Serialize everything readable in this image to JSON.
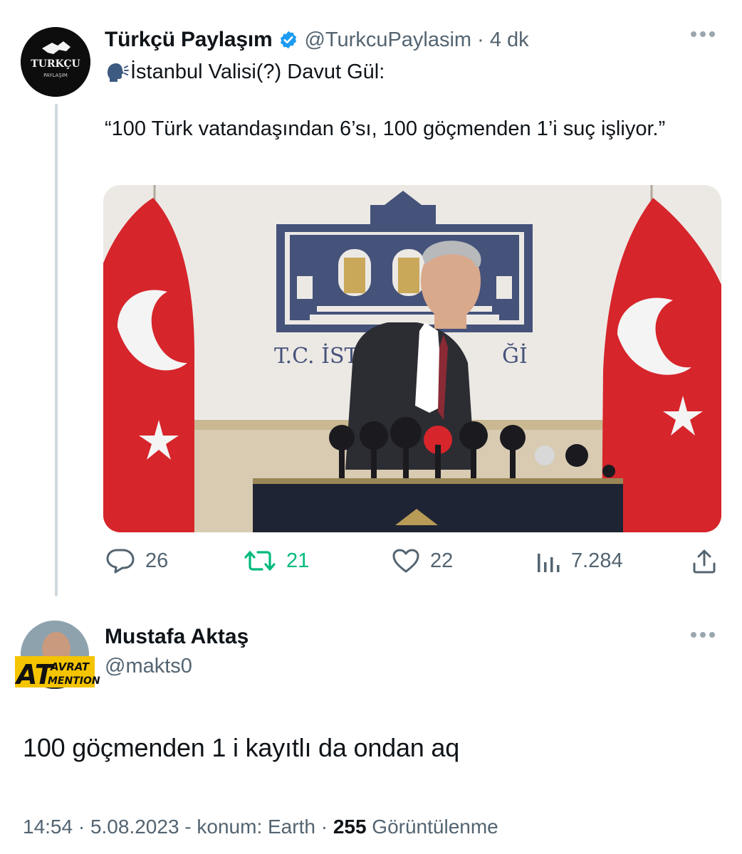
{
  "tweet": {
    "author_name": "Türkçü Paylaşım",
    "handle_time": "@TurkcuPaylasim · 4 dk",
    "avatar_text_top": "TURKÇU",
    "avatar_text_bottom": "PAYLAŞIM",
    "speaker_emoji": "speaking-head-icon",
    "text_line1": "İstanbul Valisi(?) Davut Gül:",
    "quote": "“100 Türk vatandaşından 6’sı, 100 göçmenden 1’i suç işliyor.”",
    "media": {
      "sign_text": "T.C. İSTA",
      "sign_text_right": "Ğİ"
    },
    "actions": {
      "replies": "26",
      "retweets": "21",
      "likes": "22",
      "views": "7.284"
    }
  },
  "reply": {
    "author_name": "Mustafa Aktaş",
    "handle": "@makts0",
    "badge_big": "AT",
    "badge_top": "AVRAT",
    "badge_bottom": "MENTION",
    "text": "100 göçmenden 1 i kayıtlı da ondan aq",
    "meta_prefix": "14:54 · 5.08.2023 - konum: Earth · ",
    "meta_views": "255",
    "meta_suffix": " Görüntülenme"
  },
  "colors": {
    "verified_blue": "#1d9bf0",
    "retweet_green": "#00ba7c",
    "muted": "#536471",
    "flag_red": "#d6252b"
  }
}
